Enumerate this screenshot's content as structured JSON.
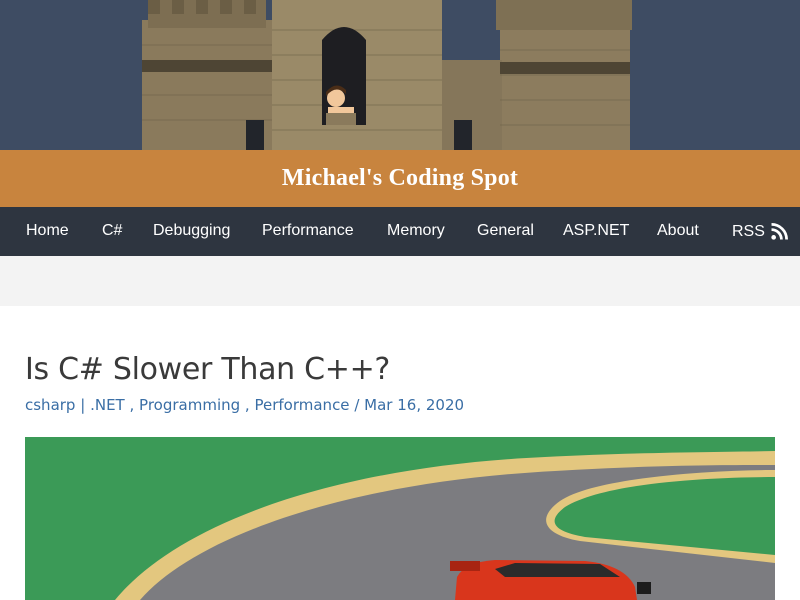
{
  "site": {
    "title": "Michael's Coding Spot"
  },
  "nav": {
    "items": [
      {
        "label": "Home"
      },
      {
        "label": "C#"
      },
      {
        "label": "Debugging"
      },
      {
        "label": "Performance"
      },
      {
        "label": "Memory"
      },
      {
        "label": "General"
      },
      {
        "label": "ASP.NET"
      },
      {
        "label": "About"
      },
      {
        "label": "RSS",
        "icon": "rss-icon"
      }
    ]
  },
  "post": {
    "title": "Is C# Slower Than C++?",
    "meta": {
      "author": "csharp",
      "divider": "|",
      "categories": [
        ".NET",
        "Programming",
        "Performance"
      ],
      "date_separator": "/",
      "date": "Mar 16, 2020"
    }
  },
  "colors": {
    "sky": "#3e4c63",
    "title_bar": "#c8843e",
    "nav_bg": "#2e3540",
    "link": "#3a6ea5",
    "grass": "#3b9a57",
    "road": "#7c7c80",
    "road_edge": "#e3c77f",
    "car": "#d9361c"
  }
}
